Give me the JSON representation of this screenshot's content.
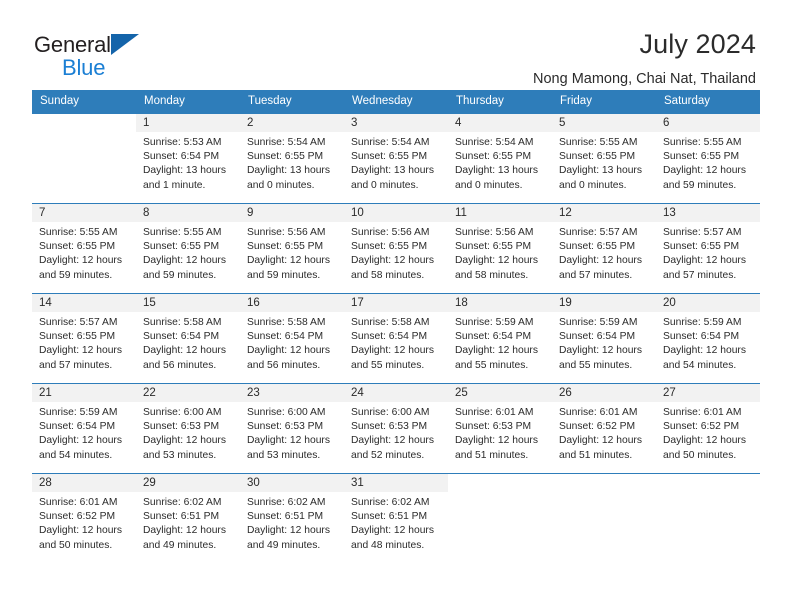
{
  "brand": {
    "name_part1": "General",
    "name_part2": "Blue",
    "triangle_color": "#1464aa",
    "blue_color": "#1b7fd4"
  },
  "header": {
    "title": "July 2024",
    "subtitle": "Nong Mamong, Chai Nat, Thailand",
    "accent_color": "#2e7dba"
  },
  "calendar": {
    "weekday_headers": [
      "Sunday",
      "Monday",
      "Tuesday",
      "Wednesday",
      "Thursday",
      "Friday",
      "Saturday"
    ],
    "weeks": [
      [
        {
          "day": "",
          "sunrise": "",
          "sunset": "",
          "daylight": "",
          "blank": true
        },
        {
          "day": "1",
          "sunrise": "Sunrise: 5:53 AM",
          "sunset": "Sunset: 6:54 PM",
          "daylight": "Daylight: 13 hours and 1 minute."
        },
        {
          "day": "2",
          "sunrise": "Sunrise: 5:54 AM",
          "sunset": "Sunset: 6:55 PM",
          "daylight": "Daylight: 13 hours and 0 minutes."
        },
        {
          "day": "3",
          "sunrise": "Sunrise: 5:54 AM",
          "sunset": "Sunset: 6:55 PM",
          "daylight": "Daylight: 13 hours and 0 minutes."
        },
        {
          "day": "4",
          "sunrise": "Sunrise: 5:54 AM",
          "sunset": "Sunset: 6:55 PM",
          "daylight": "Daylight: 13 hours and 0 minutes."
        },
        {
          "day": "5",
          "sunrise": "Sunrise: 5:55 AM",
          "sunset": "Sunset: 6:55 PM",
          "daylight": "Daylight: 13 hours and 0 minutes."
        },
        {
          "day": "6",
          "sunrise": "Sunrise: 5:55 AM",
          "sunset": "Sunset: 6:55 PM",
          "daylight": "Daylight: 12 hours and 59 minutes."
        }
      ],
      [
        {
          "day": "7",
          "sunrise": "Sunrise: 5:55 AM",
          "sunset": "Sunset: 6:55 PM",
          "daylight": "Daylight: 12 hours and 59 minutes."
        },
        {
          "day": "8",
          "sunrise": "Sunrise: 5:55 AM",
          "sunset": "Sunset: 6:55 PM",
          "daylight": "Daylight: 12 hours and 59 minutes."
        },
        {
          "day": "9",
          "sunrise": "Sunrise: 5:56 AM",
          "sunset": "Sunset: 6:55 PM",
          "daylight": "Daylight: 12 hours and 59 minutes."
        },
        {
          "day": "10",
          "sunrise": "Sunrise: 5:56 AM",
          "sunset": "Sunset: 6:55 PM",
          "daylight": "Daylight: 12 hours and 58 minutes."
        },
        {
          "day": "11",
          "sunrise": "Sunrise: 5:56 AM",
          "sunset": "Sunset: 6:55 PM",
          "daylight": "Daylight: 12 hours and 58 minutes."
        },
        {
          "day": "12",
          "sunrise": "Sunrise: 5:57 AM",
          "sunset": "Sunset: 6:55 PM",
          "daylight": "Daylight: 12 hours and 57 minutes."
        },
        {
          "day": "13",
          "sunrise": "Sunrise: 5:57 AM",
          "sunset": "Sunset: 6:55 PM",
          "daylight": "Daylight: 12 hours and 57 minutes."
        }
      ],
      [
        {
          "day": "14",
          "sunrise": "Sunrise: 5:57 AM",
          "sunset": "Sunset: 6:55 PM",
          "daylight": "Daylight: 12 hours and 57 minutes."
        },
        {
          "day": "15",
          "sunrise": "Sunrise: 5:58 AM",
          "sunset": "Sunset: 6:54 PM",
          "daylight": "Daylight: 12 hours and 56 minutes."
        },
        {
          "day": "16",
          "sunrise": "Sunrise: 5:58 AM",
          "sunset": "Sunset: 6:54 PM",
          "daylight": "Daylight: 12 hours and 56 minutes."
        },
        {
          "day": "17",
          "sunrise": "Sunrise: 5:58 AM",
          "sunset": "Sunset: 6:54 PM",
          "daylight": "Daylight: 12 hours and 55 minutes."
        },
        {
          "day": "18",
          "sunrise": "Sunrise: 5:59 AM",
          "sunset": "Sunset: 6:54 PM",
          "daylight": "Daylight: 12 hours and 55 minutes."
        },
        {
          "day": "19",
          "sunrise": "Sunrise: 5:59 AM",
          "sunset": "Sunset: 6:54 PM",
          "daylight": "Daylight: 12 hours and 55 minutes."
        },
        {
          "day": "20",
          "sunrise": "Sunrise: 5:59 AM",
          "sunset": "Sunset: 6:54 PM",
          "daylight": "Daylight: 12 hours and 54 minutes."
        }
      ],
      [
        {
          "day": "21",
          "sunrise": "Sunrise: 5:59 AM",
          "sunset": "Sunset: 6:54 PM",
          "daylight": "Daylight: 12 hours and 54 minutes."
        },
        {
          "day": "22",
          "sunrise": "Sunrise: 6:00 AM",
          "sunset": "Sunset: 6:53 PM",
          "daylight": "Daylight: 12 hours and 53 minutes."
        },
        {
          "day": "23",
          "sunrise": "Sunrise: 6:00 AM",
          "sunset": "Sunset: 6:53 PM",
          "daylight": "Daylight: 12 hours and 53 minutes."
        },
        {
          "day": "24",
          "sunrise": "Sunrise: 6:00 AM",
          "sunset": "Sunset: 6:53 PM",
          "daylight": "Daylight: 12 hours and 52 minutes."
        },
        {
          "day": "25",
          "sunrise": "Sunrise: 6:01 AM",
          "sunset": "Sunset: 6:53 PM",
          "daylight": "Daylight: 12 hours and 51 minutes."
        },
        {
          "day": "26",
          "sunrise": "Sunrise: 6:01 AM",
          "sunset": "Sunset: 6:52 PM",
          "daylight": "Daylight: 12 hours and 51 minutes."
        },
        {
          "day": "27",
          "sunrise": "Sunrise: 6:01 AM",
          "sunset": "Sunset: 6:52 PM",
          "daylight": "Daylight: 12 hours and 50 minutes."
        }
      ],
      [
        {
          "day": "28",
          "sunrise": "Sunrise: 6:01 AM",
          "sunset": "Sunset: 6:52 PM",
          "daylight": "Daylight: 12 hours and 50 minutes."
        },
        {
          "day": "29",
          "sunrise": "Sunrise: 6:02 AM",
          "sunset": "Sunset: 6:51 PM",
          "daylight": "Daylight: 12 hours and 49 minutes."
        },
        {
          "day": "30",
          "sunrise": "Sunrise: 6:02 AM",
          "sunset": "Sunset: 6:51 PM",
          "daylight": "Daylight: 12 hours and 49 minutes."
        },
        {
          "day": "31",
          "sunrise": "Sunrise: 6:02 AM",
          "sunset": "Sunset: 6:51 PM",
          "daylight": "Daylight: 12 hours and 48 minutes."
        },
        {
          "day": "",
          "sunrise": "",
          "sunset": "",
          "daylight": "",
          "blank": true
        },
        {
          "day": "",
          "sunrise": "",
          "sunset": "",
          "daylight": "",
          "blank": true
        },
        {
          "day": "",
          "sunrise": "",
          "sunset": "",
          "daylight": "",
          "blank": true
        }
      ]
    ]
  }
}
